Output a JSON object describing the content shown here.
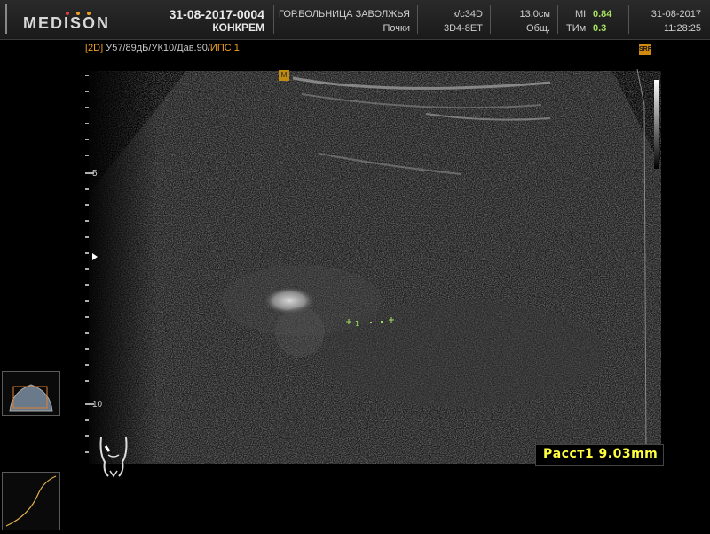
{
  "header": {
    "logo": "MEDISON",
    "patient_id": "31-08-2017-0004",
    "patient_name": "КОНКРЕМ",
    "hospital": "ГОР.БОЛЬНИЦА ЗАВОЛЖЬЯ",
    "application": "Почки",
    "probe_code": "к/с34D",
    "probe_model": "3D4-8ET",
    "depth": "13.0см",
    "preset": "Общ.",
    "mi_label": "MI",
    "mi_value": "0.84",
    "tim_label": "ТИм",
    "tim_value": "0.3",
    "date": "31-08-2017",
    "time": "11:28:25"
  },
  "params": {
    "mode": "[2D]",
    "settings": "У57/89дБ/УК10/Дав.90/",
    "ips": "ИПС 1"
  },
  "scale": {
    "label_5": "5",
    "label_10": "10"
  },
  "orientation_marker": "M",
  "sri_badge": "SRF",
  "measurement": {
    "text": "Расст1 9.03mm"
  },
  "caliper_label": "1",
  "colors": {
    "header_bg": "#1e1e1e",
    "accent_orange": "#f0a020",
    "mi_green": "#a8e060",
    "measure_yellow": "#ffff40"
  }
}
